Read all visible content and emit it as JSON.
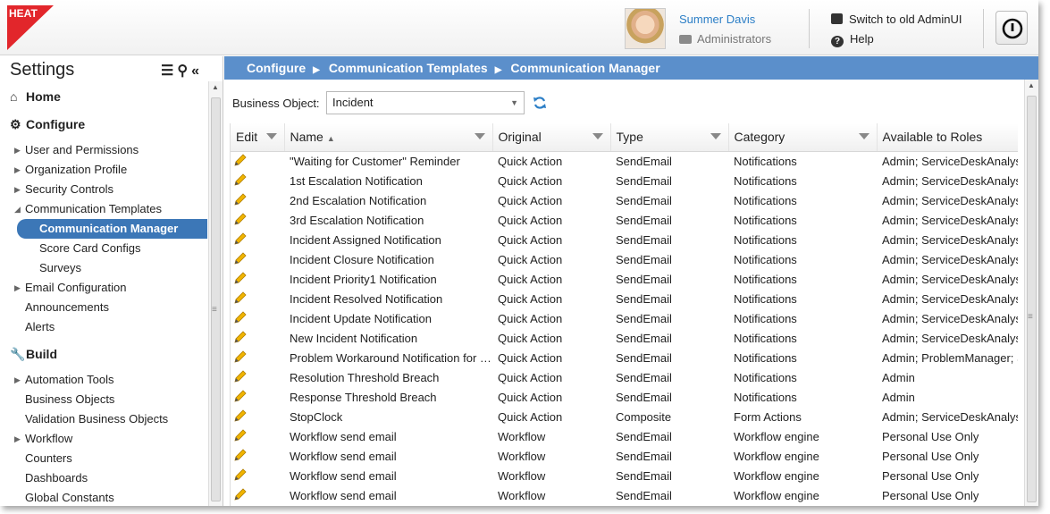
{
  "header": {
    "logo_text": "HEAT",
    "user_name": "Summer Davis",
    "user_role": "Administrators",
    "switch_label": "Switch to old AdminUI",
    "help_label": "Help"
  },
  "sidebar": {
    "title": "Settings",
    "sections": [
      {
        "label": "Home",
        "icon": "home-icon",
        "items": []
      },
      {
        "label": "Configure",
        "icon": "gear-icon",
        "items": [
          {
            "label": "User and Permissions",
            "expandable": true
          },
          {
            "label": "Organization Profile",
            "expandable": true
          },
          {
            "label": "Security Controls",
            "expandable": true
          },
          {
            "label": "Communication Templates",
            "expanded": true
          },
          {
            "label": "Communication Manager",
            "sub": true,
            "selected": true
          },
          {
            "label": "Score Card Configs",
            "sub": true
          },
          {
            "label": "Surveys",
            "sub": true
          },
          {
            "label": "Email Configuration",
            "expandable": true
          },
          {
            "label": "Announcements"
          },
          {
            "label": "Alerts"
          }
        ]
      },
      {
        "label": "Build",
        "icon": "wrench-icon",
        "items": [
          {
            "label": "Automation Tools",
            "expandable": true
          },
          {
            "label": "Business Objects"
          },
          {
            "label": "Validation Business Objects"
          },
          {
            "label": "Workflow",
            "expandable": true
          },
          {
            "label": "Counters"
          },
          {
            "label": "Dashboards"
          },
          {
            "label": "Global Constants"
          }
        ]
      }
    ]
  },
  "breadcrumb": [
    "Configure",
    "Communication Templates",
    "Communication Manager"
  ],
  "business_object": {
    "label": "Business Object:",
    "value": "Incident"
  },
  "grid": {
    "columns": [
      "Edit",
      "Name",
      "Original",
      "Type",
      "Category",
      "Available to Roles"
    ],
    "rows": [
      [
        "\"Waiting for Customer\" Reminder",
        "Quick Action",
        "SendEmail",
        "Notifications",
        "Admin; ServiceDeskAnalyst"
      ],
      [
        "1st Escalation Notification",
        "Quick Action",
        "SendEmail",
        "Notifications",
        "Admin; ServiceDeskAnalyst"
      ],
      [
        "2nd Escalation Notification",
        "Quick Action",
        "SendEmail",
        "Notifications",
        "Admin; ServiceDeskAnalyst"
      ],
      [
        "3rd Escalation Notification",
        "Quick Action",
        "SendEmail",
        "Notifications",
        "Admin; ServiceDeskAnalyst"
      ],
      [
        "Incident Assigned Notification",
        "Quick Action",
        "SendEmail",
        "Notifications",
        "Admin; ServiceDeskAnalyst"
      ],
      [
        "Incident Closure Notification",
        "Quick Action",
        "SendEmail",
        "Notifications",
        "Admin; ServiceDeskAnalyst"
      ],
      [
        "Incident Priority1 Notification",
        "Quick Action",
        "SendEmail",
        "Notifications",
        "Admin; ServiceDeskAnalyst"
      ],
      [
        "Incident Resolved Notification",
        "Quick Action",
        "SendEmail",
        "Notifications",
        "Admin; ServiceDeskAnalyst"
      ],
      [
        "Incident Update Notification",
        "Quick Action",
        "SendEmail",
        "Notifications",
        "Admin; ServiceDeskAnalyst"
      ],
      [
        "New Incident Notification",
        "Quick Action",
        "SendEmail",
        "Notifications",
        "Admin; ServiceDeskAnalyst"
      ],
      [
        "Problem Workaround Notification for Incident",
        "Quick Action",
        "SendEmail",
        "Notifications",
        "Admin; ProblemManager; ServiceDeskAnalyst"
      ],
      [
        "Resolution Threshold Breach",
        "Quick Action",
        "SendEmail",
        "Notifications",
        "Admin"
      ],
      [
        "Response Threshold Breach",
        "Quick Action",
        "SendEmail",
        "Notifications",
        "Admin"
      ],
      [
        "StopClock",
        "Quick Action",
        "Composite",
        "Form Actions",
        "Admin; ServiceDeskAnalyst"
      ],
      [
        "Workflow send email",
        "Workflow",
        "SendEmail",
        "Workflow engine",
        "Personal Use Only"
      ],
      [
        "Workflow send email",
        "Workflow",
        "SendEmail",
        "Workflow engine",
        "Personal Use Only"
      ],
      [
        "Workflow send email",
        "Workflow",
        "SendEmail",
        "Workflow engine",
        "Personal Use Only"
      ],
      [
        "Workflow send email",
        "Workflow",
        "SendEmail",
        "Workflow engine",
        "Personal Use Only"
      ]
    ]
  },
  "colors": {
    "accent": "#3c77b7",
    "breadcrumb_bg": "#5b8fcb",
    "user_link": "#2b7ec6",
    "logo_red": "#e2262b",
    "pencil": "#f0b400"
  }
}
